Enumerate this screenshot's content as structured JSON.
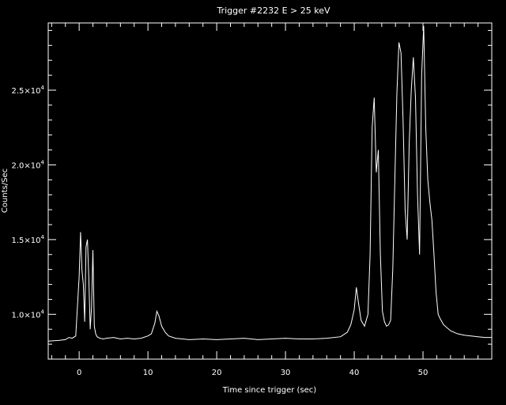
{
  "chart_data": {
    "type": "line",
    "title": "Trigger #2232 E > 25 keV",
    "xlabel": "Time since trigger (sec)",
    "ylabel": "Counts/Sec",
    "xlim": [
      -4.5,
      60
    ],
    "ylim": [
      7000,
      29500
    ],
    "x_ticks": [
      0,
      10,
      20,
      30,
      40,
      50
    ],
    "x_minor_step": 2,
    "y_ticks": [
      {
        "value": 10000,
        "mantissa": "1.0",
        "exponent": "4"
      },
      {
        "value": 15000,
        "mantissa": "1.5",
        "exponent": "4"
      },
      {
        "value": 20000,
        "mantissa": "2.0",
        "exponent": "4"
      },
      {
        "value": 25000,
        "mantissa": "2.5",
        "exponent": "4"
      }
    ],
    "y_minor_step": 1000,
    "times_sign": "×10",
    "grid": false,
    "colors": {
      "background": "#000000",
      "line": "#ffffff",
      "axes": "#ffffff"
    },
    "series": [
      {
        "x": [
          -4.5,
          -3.0,
          -2.0,
          -1.5,
          -1.0,
          -0.5,
          0.0,
          0.2,
          0.4,
          0.6,
          0.8,
          1.0,
          1.2,
          1.4,
          1.6,
          1.8,
          2.0,
          2.2,
          2.4,
          2.6,
          2.8,
          3.0,
          3.5,
          4.0,
          5.0,
          6.0,
          7.0,
          8.0,
          9.0,
          10.0,
          10.5,
          11.0,
          11.3,
          11.6,
          12.0,
          12.5,
          13.0,
          14.0,
          15.0,
          16.0,
          18.0,
          20.0,
          22.0,
          24.0,
          26.0,
          28.0,
          30.0,
          32.0,
          34.0,
          36.0,
          38.0,
          39.0,
          39.5,
          40.0,
          40.3,
          40.6,
          41.0,
          41.5,
          42.0,
          42.3,
          42.6,
          42.9,
          43.2,
          43.5,
          43.8,
          44.1,
          44.4,
          44.7,
          45.0,
          45.3,
          45.6,
          45.9,
          46.2,
          46.5,
          46.8,
          47.1,
          47.4,
          47.7,
          48.0,
          48.3,
          48.6,
          48.9,
          49.2,
          49.5,
          49.8,
          50.1,
          50.4,
          50.7,
          51.0,
          51.3,
          51.6,
          51.9,
          52.2,
          52.5,
          53.0,
          54.0,
          55.0,
          56.0,
          57.0,
          58.0,
          59.0,
          60.0
        ],
        "y": [
          8200,
          8250,
          8300,
          8450,
          8400,
          8550,
          12500,
          15500,
          13000,
          12000,
          9500,
          14500,
          15000,
          12500,
          9000,
          10500,
          14300,
          9200,
          8700,
          8500,
          8450,
          8400,
          8350,
          8400,
          8450,
          8350,
          8400,
          8350,
          8400,
          8550,
          8700,
          9400,
          10200,
          9900,
          9200,
          8800,
          8550,
          8400,
          8350,
          8300,
          8350,
          8300,
          8350,
          8400,
          8300,
          8350,
          8400,
          8350,
          8350,
          8400,
          8500,
          8800,
          9300,
          10300,
          11800,
          10800,
          9600,
          9200,
          10000,
          14000,
          22500,
          24500,
          19500,
          21000,
          14000,
          10200,
          9500,
          9200,
          9300,
          9600,
          13000,
          19000,
          24800,
          28200,
          27500,
          23000,
          17000,
          15000,
          21500,
          25000,
          27200,
          24500,
          18000,
          14000,
          26000,
          29300,
          22500,
          19000,
          17500,
          16300,
          14000,
          11500,
          10000,
          9700,
          9300,
          8900,
          8700,
          8600,
          8550,
          8500,
          8450,
          8450
        ]
      }
    ]
  }
}
